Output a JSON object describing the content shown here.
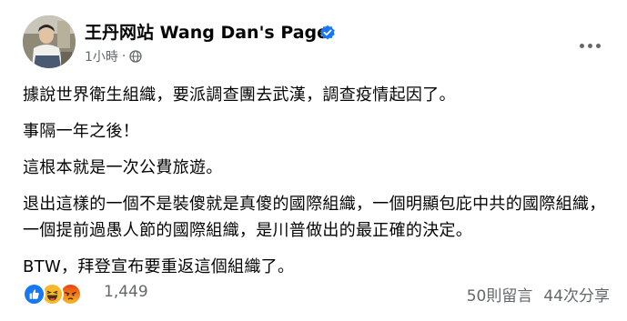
{
  "post": {
    "page_name": "王丹网站 Wang Dan's Page",
    "timestamp": "1小時",
    "separator": "·",
    "audience_icon": "globe-icon",
    "verified_icon": "verified-badge-icon",
    "paragraphs": [
      "據說世界衛生組織，要派調查團去武漢，調查疫情起因了。",
      "事隔一年之後！",
      "這根本就是一次公費旅遊。",
      "退出這樣的一個不是裝傻就是真傻的國際組織，一個明顯包庇中共的國際組織，一個提前過愚人節的國際組織，是川普做出的最正確的決定。",
      "BTW，拜登宣布要重返這個組織了。"
    ]
  },
  "footer": {
    "reactions": [
      "like",
      "haha",
      "angry"
    ],
    "reaction_count": "1,449",
    "comments": "50則留言",
    "shares": "44次分享"
  },
  "colors": {
    "link_blue": "#1877f2",
    "secondary_text": "#65676b",
    "like": "#1877f2",
    "haha": "#f7b928",
    "angry": "#e9710f"
  }
}
